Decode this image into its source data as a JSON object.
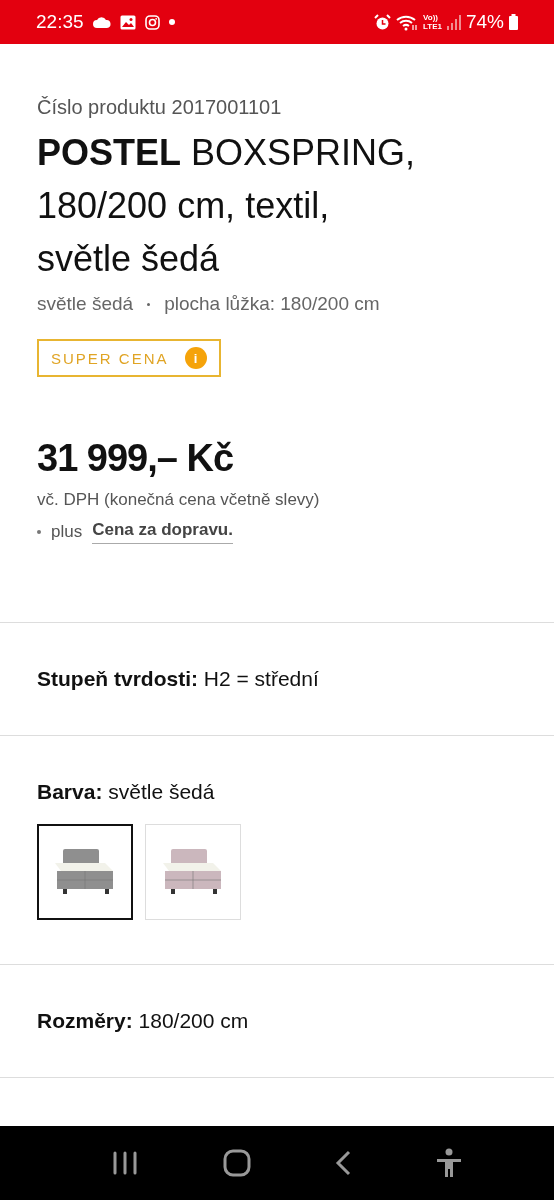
{
  "status_bar": {
    "time": "22:35",
    "volte": "Vo))",
    "network": "LTE1",
    "battery": "74%"
  },
  "product": {
    "number": "Číslo produktu 2017001101",
    "title": "**POSTEL** BOXSPRING, 180/200 cm, textil, světle šedá",
    "meta": [
      "světle šedá",
      "plocha lůžka: 180/200 cm"
    ],
    "badge": "SUPER CENA",
    "badge_icon": "i",
    "price": "31 999,– Kč",
    "vat_note": "vč. DPH (konečná cena včetně slevy)",
    "shipping_prefix": "plus",
    "shipping_link": "Cena za dopravu."
  },
  "attributes": [
    {
      "kind": "text",
      "label": "Stupeň tvrdosti:",
      "value": "H2 = střední"
    },
    {
      "kind": "swatches",
      "label": "Barva:",
      "value": "světle šedá",
      "swatches": [
        {
          "color": "#8f8f8f",
          "selected": true
        },
        {
          "color": "#cbb7bd",
          "selected": false
        }
      ]
    },
    {
      "kind": "text",
      "label": "Rozměry:",
      "value": "180/200 cm"
    }
  ]
}
